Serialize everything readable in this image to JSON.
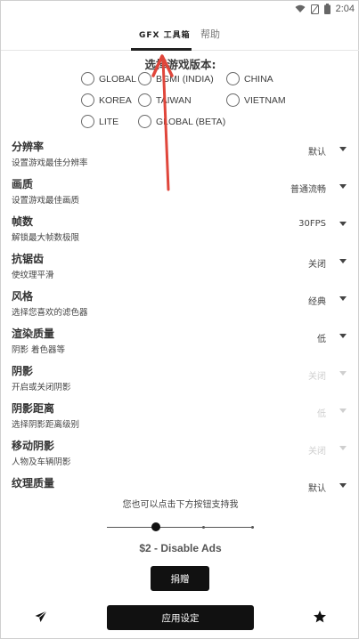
{
  "status_bar": {
    "time": "2:04",
    "icons": [
      "wifi-icon",
      "no-sim-icon",
      "battery-icon"
    ]
  },
  "tabs": [
    {
      "label": "GFX 工具箱",
      "active": true
    },
    {
      "label": "帮助",
      "active": false
    }
  ],
  "version": {
    "title": "选择游戏版本:",
    "options": [
      "GLOBAL",
      "BGMI (INDIA)",
      "CHINA",
      "KOREA",
      "TAIWAN",
      "VIETNAM",
      "LITE",
      "GLOBAL (BETA)"
    ]
  },
  "settings": [
    {
      "title": "分辨率",
      "desc": "设置游戏最佳分辨率",
      "value": "默认",
      "enabled": true
    },
    {
      "title": "画质",
      "desc": "设置游戏最佳画质",
      "value": "普通流畅",
      "enabled": true
    },
    {
      "title": "帧数",
      "desc": "解锁最大帧数极限",
      "value": "30FPS",
      "enabled": true
    },
    {
      "title": "抗锯齿",
      "desc": "使纹理平滑",
      "value": "关闭",
      "enabled": true
    },
    {
      "title": "风格",
      "desc": "选择您喜欢的滤色器",
      "value": "经典",
      "enabled": true
    },
    {
      "title": "渲染质量",
      "desc": "阴影 着色器等",
      "value": "低",
      "enabled": true
    },
    {
      "title": "阴影",
      "desc": "开启或关闭阴影",
      "value": "关闭",
      "enabled": false
    },
    {
      "title": "阴影距离",
      "desc": "选择阴影距离级别",
      "value": "低",
      "enabled": false
    },
    {
      "title": "移动阴影",
      "desc": "人物及车辆阴影",
      "value": "关闭",
      "enabled": false
    },
    {
      "title": "纹理质量",
      "desc": "",
      "value": "默认",
      "enabled": true
    }
  ],
  "support": {
    "text": "您也可以点击下方按钮支持我",
    "price": "$2 - Disable Ads",
    "donate_label": "捐赠",
    "slider_position": 0.33
  },
  "bottom": {
    "apply_label": "应用设定",
    "left_icon": "send-icon",
    "right_icon": "star-icon"
  },
  "colors": {
    "accent": "#111111",
    "annotation_arrow": "#e0463b"
  }
}
